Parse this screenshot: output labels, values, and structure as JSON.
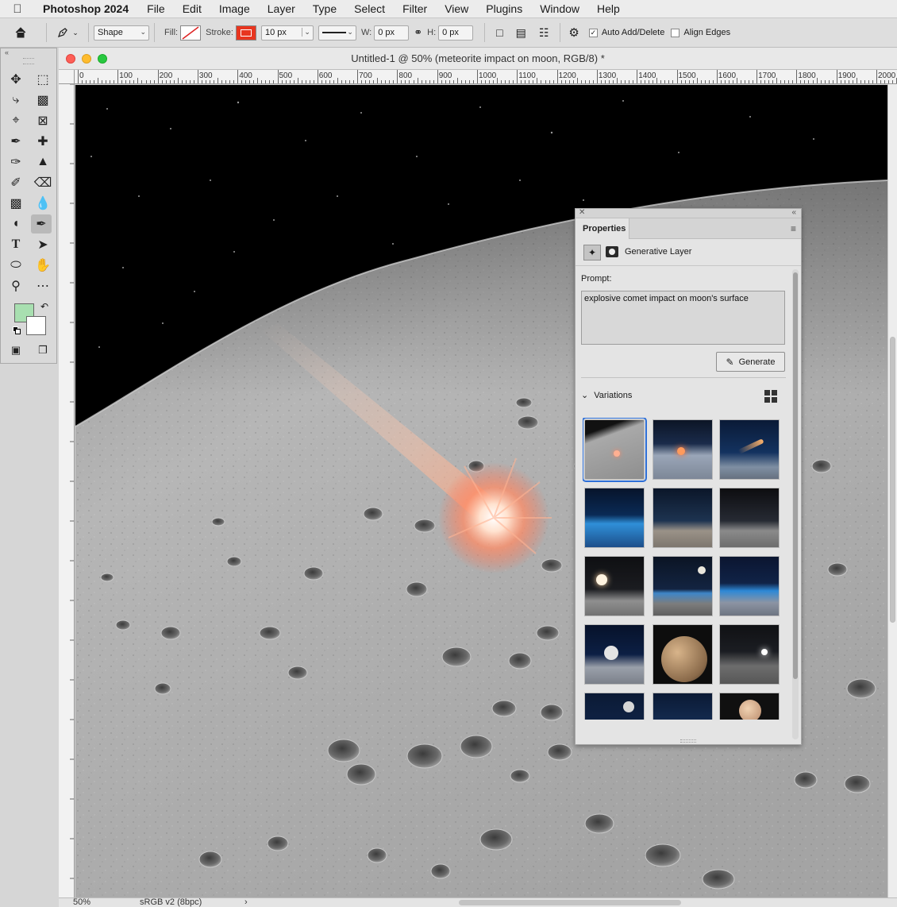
{
  "menubar": {
    "app_name": "Photoshop 2024",
    "items": [
      "File",
      "Edit",
      "Image",
      "Layer",
      "Type",
      "Select",
      "Filter",
      "View",
      "Plugins",
      "Window",
      "Help"
    ]
  },
  "options_bar": {
    "mode_value": "Shape",
    "fill_label": "Fill:",
    "stroke_label": "Stroke:",
    "stroke_color": "#e8351f",
    "stroke_width": "10 px",
    "w_label": "W:",
    "w_value": "0 px",
    "h_label": "H:",
    "h_value": "0 px",
    "auto_add_delete": {
      "label": "Auto Add/Delete",
      "checked": true
    },
    "align_edges": {
      "label": "Align Edges",
      "checked": false
    }
  },
  "tools": {
    "foreground_color": "#a8dfb0",
    "background_color": "#ffffff",
    "active_tool": "pen-tool"
  },
  "document": {
    "title": "Untitled-1 @ 50% (meteorite impact on moon, RGB/8) *",
    "ruler_labels": [
      "0",
      "100",
      "200",
      "300",
      "400",
      "500",
      "600",
      "700",
      "800",
      "900",
      "1000",
      "1100",
      "1200",
      "1300",
      "1400",
      "1500",
      "1600",
      "1700",
      "1800",
      "1900",
      "2000"
    ],
    "status_zoom": "50%",
    "status_profile": "sRGB v2 (8bpc)",
    "status_arrow": "›"
  },
  "properties": {
    "tab_label": "Properties",
    "layer_type": "Generative Layer",
    "prompt_label": "Prompt:",
    "prompt_value": "explosive comet impact on moon's surface",
    "generate_label": "Generate",
    "variations_label": "Variations"
  }
}
